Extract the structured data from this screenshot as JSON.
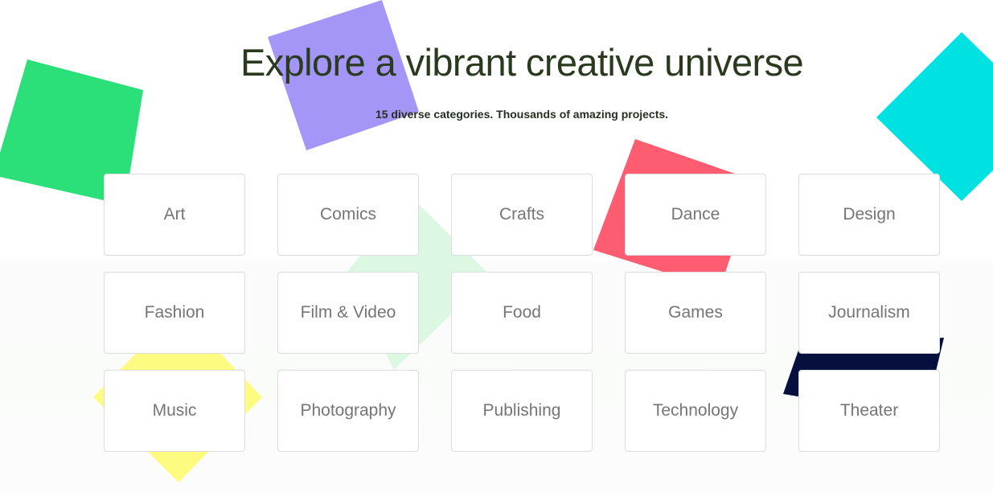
{
  "header": {
    "title": "Explore a vibrant creative universe",
    "subtitle": "15 diverse categories. Thousands of amazing projects."
  },
  "categories": [
    {
      "label": "Art"
    },
    {
      "label": "Comics"
    },
    {
      "label": "Crafts"
    },
    {
      "label": "Dance"
    },
    {
      "label": "Design"
    },
    {
      "label": "Fashion"
    },
    {
      "label": "Film & Video"
    },
    {
      "label": "Food"
    },
    {
      "label": "Games"
    },
    {
      "label": "Journalism"
    },
    {
      "label": "Music"
    },
    {
      "label": "Photography"
    },
    {
      "label": "Publishing"
    },
    {
      "label": "Technology"
    },
    {
      "label": "Theater"
    }
  ],
  "decorative_shapes": {
    "green_square": "#2bdf79",
    "purple_square": "#a396f7",
    "cyan_diamond": "#00e2e2",
    "red_square": "#fe5c70",
    "light_green_diamond": "#dcf7e2",
    "yellow_diamond": "#fefc80",
    "navy_square": "#05103f"
  }
}
